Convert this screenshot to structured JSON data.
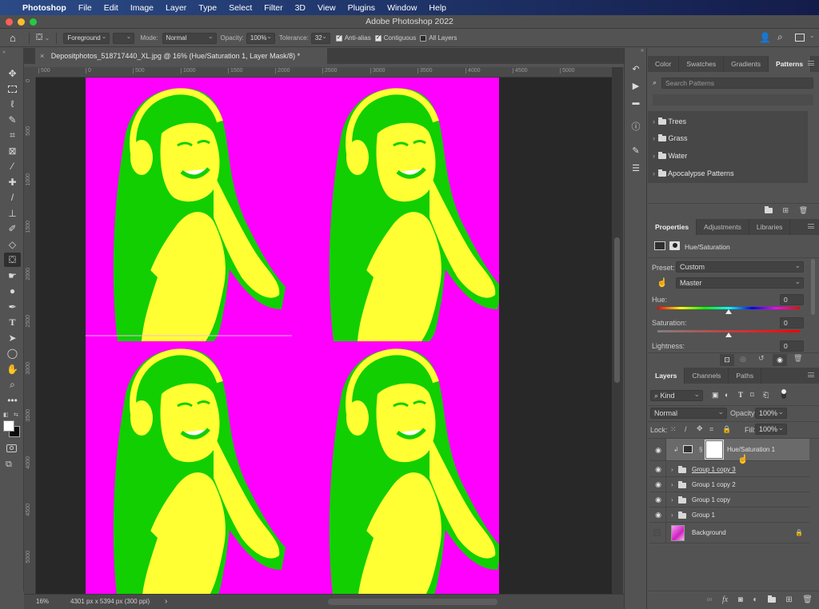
{
  "menubar": {
    "apple": "",
    "items": [
      "Photoshop",
      "File",
      "Edit",
      "Image",
      "Layer",
      "Type",
      "Select",
      "Filter",
      "3D",
      "View",
      "Plugins",
      "Window",
      "Help"
    ]
  },
  "window": {
    "title": "Adobe Photoshop 2022"
  },
  "options": {
    "fill_source": "Foreground",
    "mode_label": "Mode:",
    "mode_value": "Normal",
    "opacity_label": "Opacity:",
    "opacity_value": "100%",
    "tolerance_label": "Tolerance:",
    "tolerance_value": "32",
    "anti_alias_label": "Anti-alias",
    "anti_alias_checked": true,
    "contiguous_label": "Contiguous",
    "contiguous_checked": true,
    "all_layers_label": "All Layers",
    "all_layers_checked": false
  },
  "document": {
    "tab_title": "Depositphotos_518717440_XL.jpg @ 16% (Hue/Saturation 1, Layer Mask/8) *",
    "close": "×",
    "colors": {
      "background": "#ff00ff",
      "green": "#11cf00",
      "yellow": "#ffff33"
    }
  },
  "rulers": {
    "h": [
      "500",
      "0",
      "500",
      "1000",
      "1500",
      "2000",
      "2500",
      "3000",
      "3500",
      "4000",
      "4500",
      "5000"
    ],
    "v": [
      "0",
      "500",
      "1000",
      "1500",
      "2000",
      "2500",
      "3000",
      "3500",
      "4000",
      "4500",
      "5000"
    ]
  },
  "tools": [
    "move",
    "marquee",
    "lasso",
    "quick-select",
    "crop",
    "frame",
    "eyedropper",
    "healing",
    "brush",
    "stamp",
    "history-brush",
    "eraser",
    "paint-bucket",
    "smudge",
    "dodge",
    "pen",
    "type",
    "path-select",
    "ellipse",
    "hand",
    "zoom",
    "more"
  ],
  "status": {
    "zoom": "16%",
    "doc_info": "4301 px x 5394 px (300 ppi)",
    "arrow": "›"
  },
  "patterns_panel": {
    "tabs": [
      "Color",
      "Swatches",
      "Gradients",
      "Patterns"
    ],
    "active_tab": "Patterns",
    "search_placeholder": "Search Patterns",
    "groups": [
      "Trees",
      "Grass",
      "Water",
      "Apocalypse Patterns"
    ]
  },
  "properties_panel": {
    "tabs": [
      "Properties",
      "Adjustments",
      "Libraries"
    ],
    "active_tab": "Properties",
    "adjustment_name": "Hue/Saturation",
    "preset_label": "Preset:",
    "preset_value": "Custom",
    "channel_value": "Master",
    "hue_label": "Hue:",
    "hue_value": "0",
    "saturation_label": "Saturation:",
    "saturation_value": "0",
    "lightness_label": "Lightness:",
    "lightness_value": "0",
    "hue_slider_position": 0.5,
    "saturation_slider_position": 0.5
  },
  "layers_panel": {
    "tabs": [
      "Layers",
      "Channels",
      "Paths"
    ],
    "active_tab": "Layers",
    "filter_kind": "Kind",
    "blend_mode": "Normal",
    "opacity_label": "Opacity:",
    "opacity_value": "100%",
    "lock_label": "Lock:",
    "fill_label": "Fill:",
    "fill_value": "100%",
    "layers": [
      {
        "name": "Hue/Saturation 1",
        "type": "adjustment",
        "visible": true,
        "selected": true
      },
      {
        "name": "Group 1 copy 3",
        "type": "group",
        "visible": true,
        "selected": false
      },
      {
        "name": "Group 1 copy 2",
        "type": "group",
        "visible": true,
        "selected": false
      },
      {
        "name": "Group 1 copy",
        "type": "group",
        "visible": true,
        "selected": false
      },
      {
        "name": "Group 1",
        "type": "group",
        "visible": true,
        "selected": false
      },
      {
        "name": "Background",
        "type": "image",
        "visible": false,
        "locked": true,
        "selected": false
      }
    ]
  }
}
